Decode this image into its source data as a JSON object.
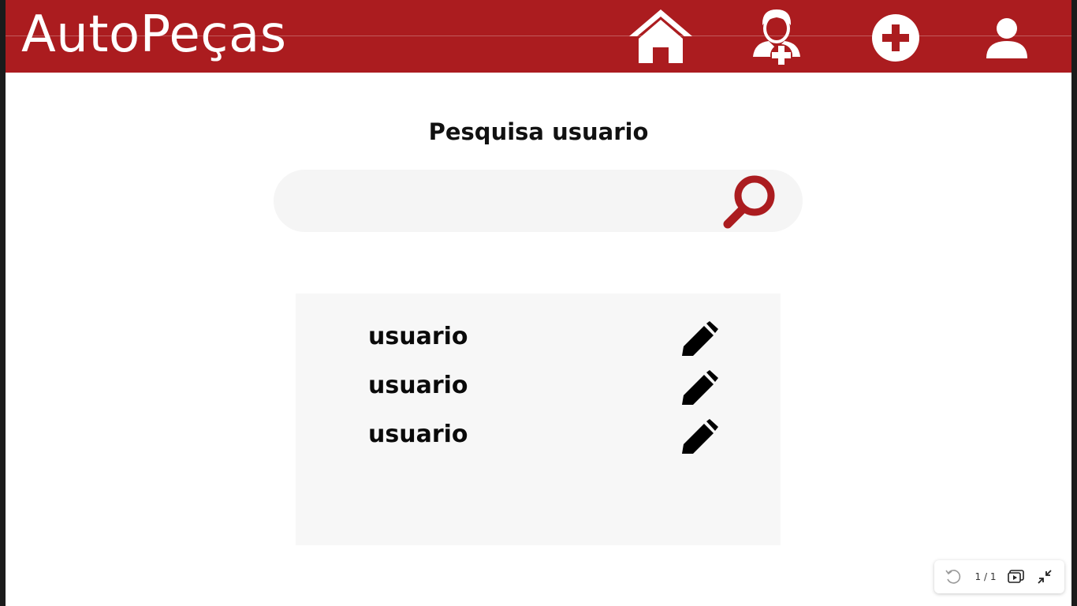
{
  "header": {
    "logo_text": "AutoPeças",
    "brand_color": "#ab1c1f",
    "nav_icons": [
      "home-icon",
      "add-user-icon",
      "plus-circle-icon",
      "user-profile-icon"
    ]
  },
  "main": {
    "title": "Pesquisa usuario",
    "search": {
      "value": "",
      "placeholder": "",
      "icon": "magnifier-icon"
    },
    "results": [
      {
        "name": "usuario",
        "action_icon": "pencil-edit-icon"
      },
      {
        "name": "usuario",
        "action_icon": "pencil-edit-icon"
      },
      {
        "name": "usuario",
        "action_icon": "pencil-edit-icon"
      }
    ]
  },
  "viewer_toolbar": {
    "page_counter": "1 / 1",
    "icons": [
      "rotate-icon",
      "present-icon",
      "collapse-icon"
    ]
  }
}
